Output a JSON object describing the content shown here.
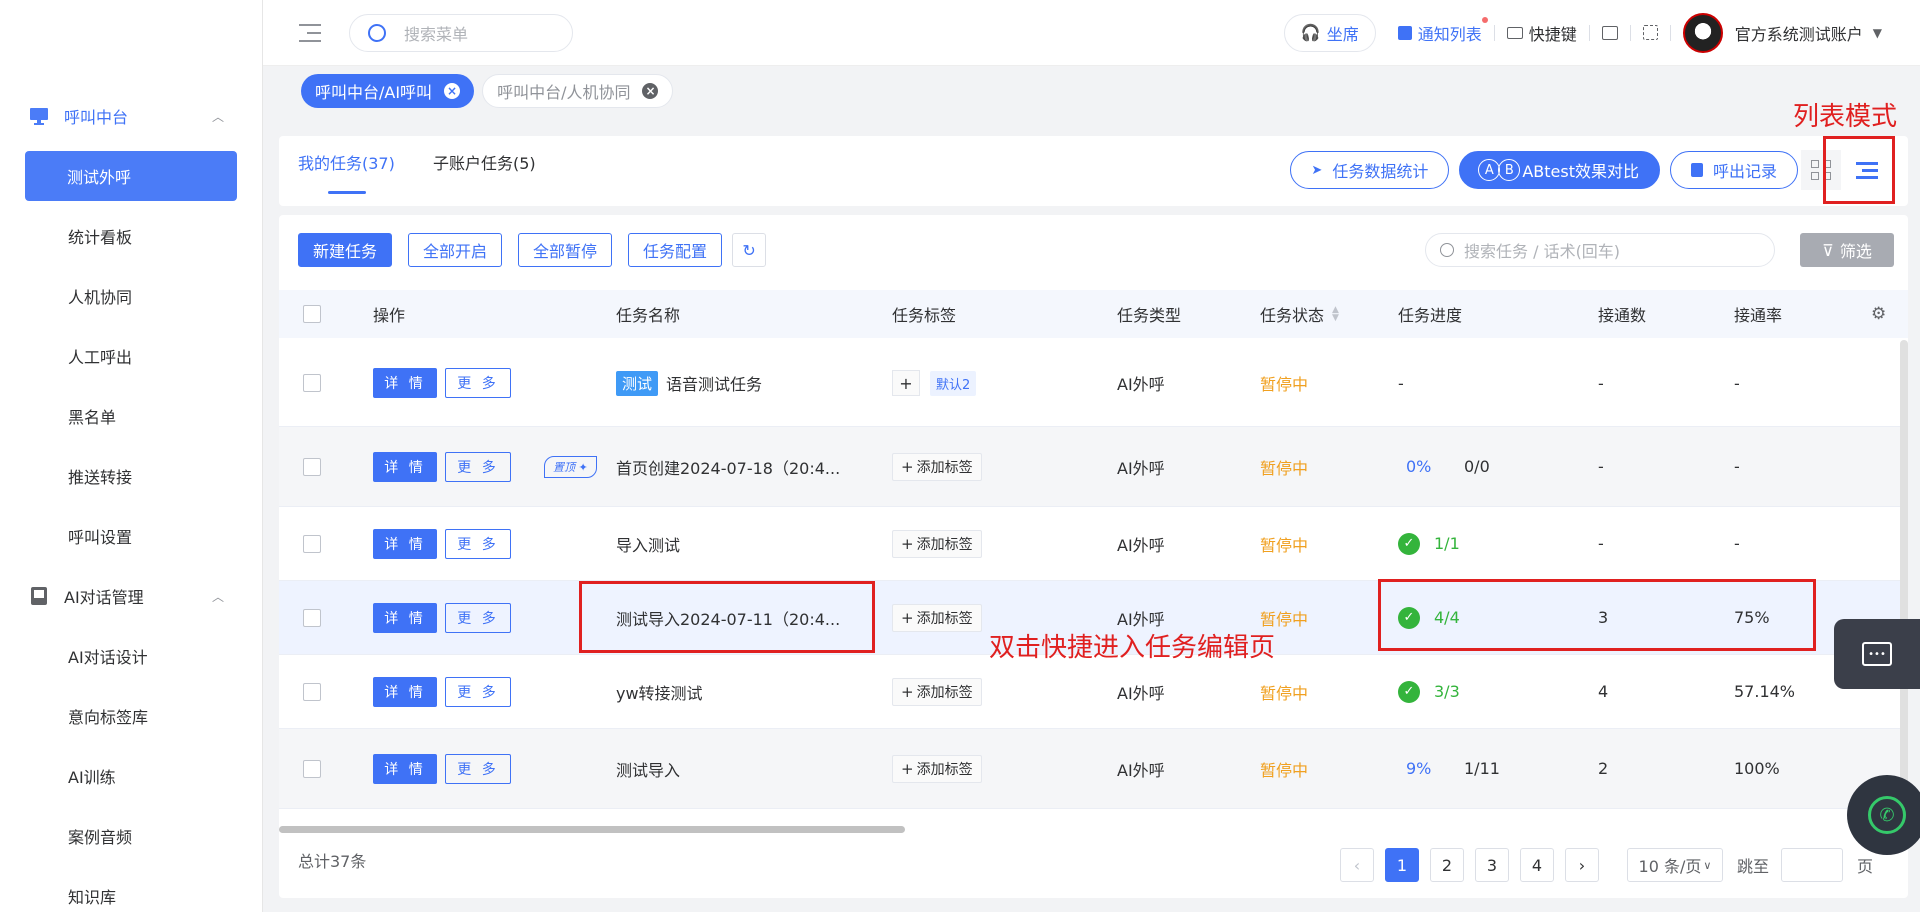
{
  "sidebar": {
    "groups": [
      {
        "label": "呼叫中台",
        "icon": "monitor-icon",
        "items": [
          "测试外呼",
          "统计看板",
          "人机协同",
          "人工呼出",
          "黑名单",
          "推送转接",
          "呼叫设置"
        ]
      },
      {
        "label": "AI对话管理",
        "icon": "book-icon",
        "items": [
          "AI对话设计",
          "意向标签库",
          "AI训练",
          "案例音频",
          "知识库"
        ]
      }
    ],
    "active": "测试外呼"
  },
  "topbar": {
    "search_placeholder": "搜索菜单",
    "seat": "坐席",
    "notice": "通知列表",
    "shortcut": "快捷键",
    "account": "官方系统测试账户"
  },
  "tags": [
    {
      "label": "呼叫中台/AI呼叫",
      "active": true
    },
    {
      "label": "呼叫中台/人机协同",
      "active": false
    }
  ],
  "tabs": [
    {
      "label": "我的任务(37)",
      "active": true
    },
    {
      "label": "子账户任务(5)",
      "active": false
    }
  ],
  "header_buttons": {
    "stats": "任务数据统计",
    "abtest_badge_a": "A",
    "abtest_badge_b": "B",
    "abtest": "ABtest效果对比",
    "call_records": "呼出记录"
  },
  "annotations": {
    "list_mode": "列表模式",
    "double_click": "双击快捷进入任务编辑页"
  },
  "toolbar": {
    "new_task": "新建任务",
    "start_all": "全部开启",
    "pause_all": "全部暂停",
    "task_config": "任务配置",
    "search_placeholder": "搜索任务 / 话术(回车)",
    "filter": "筛选"
  },
  "table": {
    "columns": [
      "操作",
      "任务名称",
      "任务标签",
      "任务类型",
      "任务状态",
      "任务进度",
      "接通数",
      "接通率"
    ],
    "detail_label": "详 情",
    "more_label": "更 多",
    "add_tag_label": "添加标签",
    "rows": [
      {
        "test_badge": "测试",
        "name": "语音测试任务",
        "tag": "默认2",
        "type": "AI外呼",
        "status": "暂停中",
        "progress_pct": "",
        "progress_text": "-",
        "progress_done": false,
        "connected": "-",
        "rate": "-",
        "pinned": false
      },
      {
        "test_badge": "",
        "name": "首页创建2024-07-18（20:4...",
        "tag": "",
        "type": "AI外呼",
        "status": "暂停中",
        "progress_pct": "0%",
        "progress_text": "0/0",
        "progress_done": false,
        "connected": "-",
        "rate": "-",
        "pinned": true,
        "pin_label": "置顶"
      },
      {
        "test_badge": "",
        "name": "导入测试",
        "tag": "",
        "type": "AI外呼",
        "status": "暂停中",
        "progress_pct": "",
        "progress_text": "1/1",
        "progress_done": true,
        "connected": "-",
        "rate": "-",
        "pinned": false
      },
      {
        "test_badge": "",
        "name": "测试导入2024-07-11（20:4...",
        "tag": "",
        "type": "AI外呼",
        "status": "暂停中",
        "progress_pct": "",
        "progress_text": "4/4",
        "progress_done": true,
        "connected": "3",
        "rate": "75%",
        "pinned": false
      },
      {
        "test_badge": "",
        "name": "yw转接测试",
        "tag": "",
        "type": "AI外呼",
        "status": "暂停中",
        "progress_pct": "",
        "progress_text": "3/3",
        "progress_done": true,
        "connected": "4",
        "rate": "57.14%",
        "pinned": false
      },
      {
        "test_badge": "",
        "name": "测试导入",
        "tag": "",
        "type": "AI外呼",
        "status": "暂停中",
        "progress_pct": "9%",
        "progress_text": "1/11",
        "progress_done": false,
        "connected": "2",
        "rate": "100%",
        "pinned": false
      }
    ]
  },
  "pagination": {
    "total": "总计37条",
    "pages": [
      "1",
      "2",
      "3",
      "4"
    ],
    "page_size": "10 条/页",
    "jump_label": "跳至",
    "page_label": "页"
  },
  "colors": {
    "primary": "#3f72f6",
    "warning": "#f0a020",
    "success": "#34b43c",
    "annotation": "#e02020"
  }
}
